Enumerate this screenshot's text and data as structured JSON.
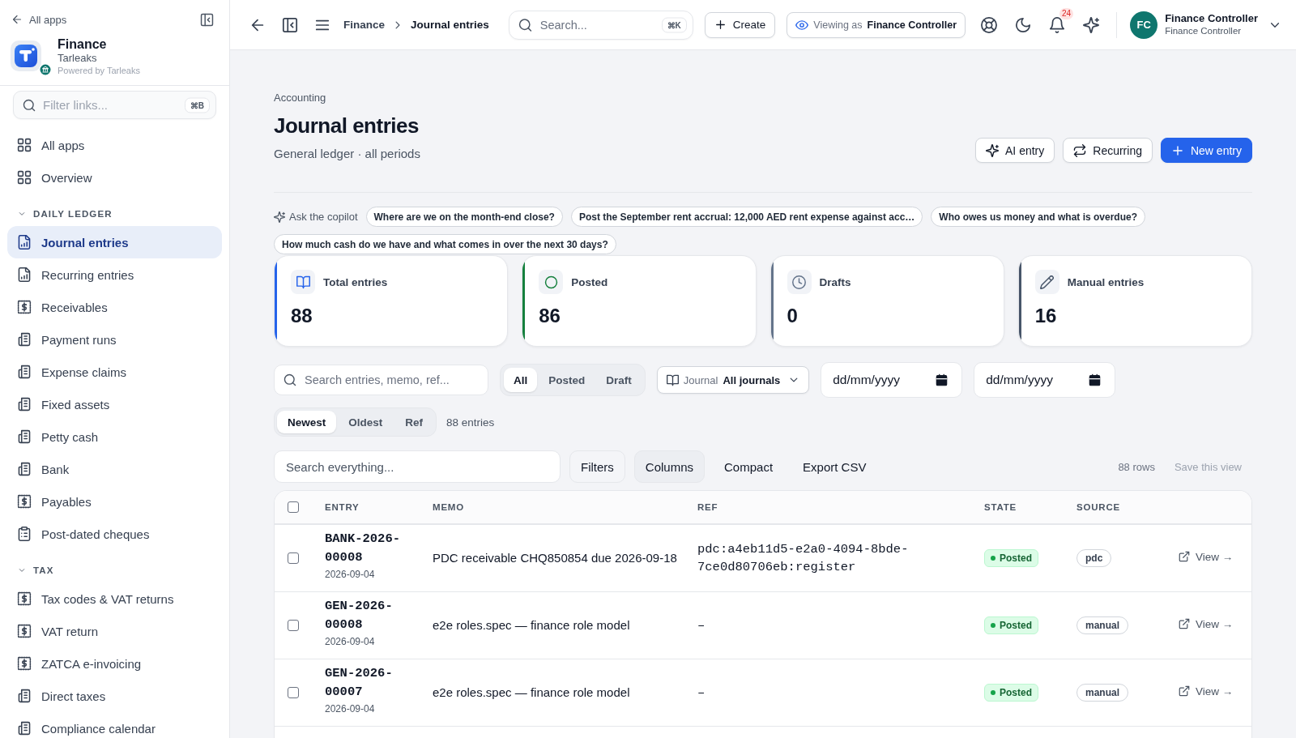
{
  "sidebar": {
    "back_link": "All apps",
    "app": {
      "name": "Finance",
      "org": "Tarleaks",
      "powered_by": "Powered by Tarleaks"
    },
    "filter": {
      "placeholder": "Filter links...",
      "shortcut": "⌘B"
    },
    "items": [
      {
        "label": "All apps",
        "kind": "grid",
        "selected": false
      },
      {
        "label": "Overview",
        "kind": "grid",
        "selected": false
      }
    ],
    "groups": [
      {
        "title": "DAILY LEDGER",
        "expanded": true,
        "items": [
          {
            "label": "Journal entries",
            "kind": "report",
            "selected": true
          },
          {
            "label": "Recurring entries",
            "kind": "report",
            "selected": false
          },
          {
            "label": "Receivables",
            "kind": "receipt",
            "selected": false
          },
          {
            "label": "Payment runs",
            "kind": "ledger",
            "selected": false
          },
          {
            "label": "Expense claims",
            "kind": "ledger",
            "selected": false
          },
          {
            "label": "Fixed assets",
            "kind": "ledger",
            "selected": false
          },
          {
            "label": "Petty cash",
            "kind": "ledger",
            "selected": false
          },
          {
            "label": "Bank",
            "kind": "ledger",
            "selected": false
          },
          {
            "label": "Payables",
            "kind": "receipt",
            "selected": false
          },
          {
            "label": "Post-dated cheques",
            "kind": "clipboard",
            "selected": false
          }
        ]
      },
      {
        "title": "TAX",
        "expanded": true,
        "items": [
          {
            "label": "Tax codes & VAT returns",
            "kind": "receipt",
            "selected": false
          },
          {
            "label": "VAT return",
            "kind": "receipt",
            "selected": false
          },
          {
            "label": "ZATCA e-invoicing",
            "kind": "receipt",
            "selected": false
          },
          {
            "label": "Direct taxes",
            "kind": "ledger",
            "selected": false
          },
          {
            "label": "Compliance calendar",
            "kind": "ledger",
            "selected": false
          }
        ]
      }
    ]
  },
  "topbar": {
    "breadcrumb": [
      "Finance",
      "Journal entries"
    ],
    "search": {
      "placeholder": "Search...",
      "shortcut": "⌘K"
    },
    "create_button": "Create",
    "viewing_as": {
      "label": "Viewing as",
      "role": "Finance Controller"
    },
    "notification_count": "24",
    "user": {
      "initials": "FC",
      "name": "Finance Controller",
      "role": "Finance Controller"
    }
  },
  "page": {
    "eyebrow": "Accounting",
    "title": "Journal entries",
    "subtitle": "General ledger · all periods",
    "actions": [
      {
        "label": "AI entry",
        "kind": "ai"
      },
      {
        "label": "Recurring",
        "kind": "recurring"
      },
      {
        "label": "New entry",
        "kind": "primary"
      }
    ]
  },
  "copilot": {
    "label": "Ask the copilot",
    "prompts": [
      "Where are we on the month-end close?",
      "Post the September rent accrual: 12,000 AED rent expense against acc…",
      "Who owes us money and what is overdue?",
      "How much cash do we have and what comes in over the next 30 days?"
    ]
  },
  "stats": [
    {
      "label": "Total entries",
      "value": "88",
      "kind": "book",
      "color": "#2563eb"
    },
    {
      "label": "Posted",
      "value": "86",
      "kind": "circle",
      "color": "#15803d"
    },
    {
      "label": "Drafts",
      "value": "0",
      "kind": "clock",
      "color": "#64748b"
    },
    {
      "label": "Manual entries",
      "value": "16",
      "kind": "pencil",
      "color": "#475569"
    }
  ],
  "filters": {
    "search": {
      "placeholder": "Search entries, memo, ref..."
    },
    "status_tabs": [
      {
        "label": "All",
        "selected": true
      },
      {
        "label": "Posted",
        "selected": false
      },
      {
        "label": "Draft",
        "selected": false
      }
    ],
    "journal": {
      "label": "Journal",
      "value": "All journals"
    },
    "date_from": {
      "placeholder": "dd/mm/yyyy"
    },
    "date_to": {
      "placeholder": "dd/mm/yyyy"
    }
  },
  "sort": {
    "tabs": [
      {
        "label": "Newest",
        "selected": true
      },
      {
        "label": "Oldest",
        "selected": false
      },
      {
        "label": "Ref",
        "selected": false
      }
    ],
    "count": "88 entries"
  },
  "toolbar": {
    "search": {
      "placeholder": "Search everything..."
    },
    "buttons": [
      {
        "label": "Filters",
        "kind": "boxed"
      },
      {
        "label": "Columns",
        "kind": "filled"
      },
      {
        "label": "Compact",
        "kind": "plain"
      },
      {
        "label": "Export CSV",
        "kind": "plain"
      }
    ],
    "row_count": "88 rows",
    "save_view": "Save this view"
  },
  "table": {
    "select_all": {
      "checked": false
    },
    "columns": [
      "ENTRY",
      "MEMO",
      "REF",
      "STATE",
      "SOURCE"
    ],
    "rows": [
      {
        "checked": false,
        "entry": "BANK-2026-00008",
        "date": "2026-09-04",
        "memo": "PDC receivable CHQ850854 due 2026-09-18",
        "ref": "pdc:a4eb11d5-e2a0-4094-8bde-7ce0d80706eb:register",
        "state": {
          "label": "Posted",
          "kind": "posted"
        },
        "source": "pdc",
        "action": "View →"
      },
      {
        "checked": false,
        "entry": "GEN-2026-00008",
        "date": "2026-09-04",
        "memo": "e2e roles.spec — finance role model",
        "ref": "–",
        "state": {
          "label": "Posted",
          "kind": "posted"
        },
        "source": "manual",
        "action": "View →"
      },
      {
        "checked": false,
        "entry": "GEN-2026-00007",
        "date": "2026-09-04",
        "memo": "e2e roles.spec — finance role model",
        "ref": "–",
        "state": {
          "label": "Posted",
          "kind": "posted"
        },
        "source": "manual",
        "action": "View →"
      }
    ]
  }
}
